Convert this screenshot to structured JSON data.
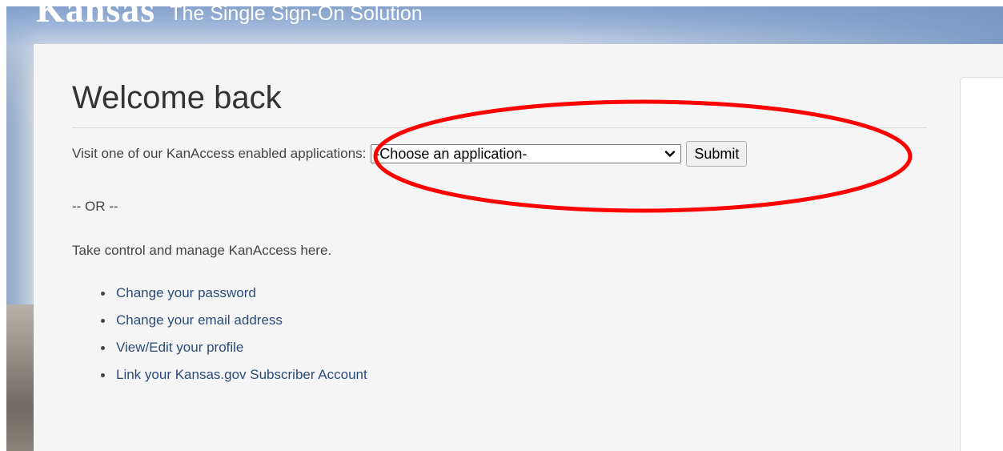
{
  "header": {
    "brand_logo": "Kansas",
    "brand_tagline": "The Single Sign-On Solution"
  },
  "main": {
    "title": "Welcome back",
    "visit_label": "Visit one of our KanAccess enabled applications:",
    "app_select": {
      "selected": "-Choose an application-"
    },
    "submit_label": "Submit",
    "or_text": "-- OR --",
    "manage_text": "Take control and manage KanAccess here.",
    "links": [
      {
        "label": "Change your password"
      },
      {
        "label": "Change your email address"
      },
      {
        "label": "View/Edit your profile"
      },
      {
        "label": "Link your Kansas.gov Subscriber Account"
      }
    ]
  },
  "colors": {
    "annotation_red": "#ff0000",
    "link_blue": "#2a4b78",
    "panel_bg": "#f5f5f5"
  }
}
